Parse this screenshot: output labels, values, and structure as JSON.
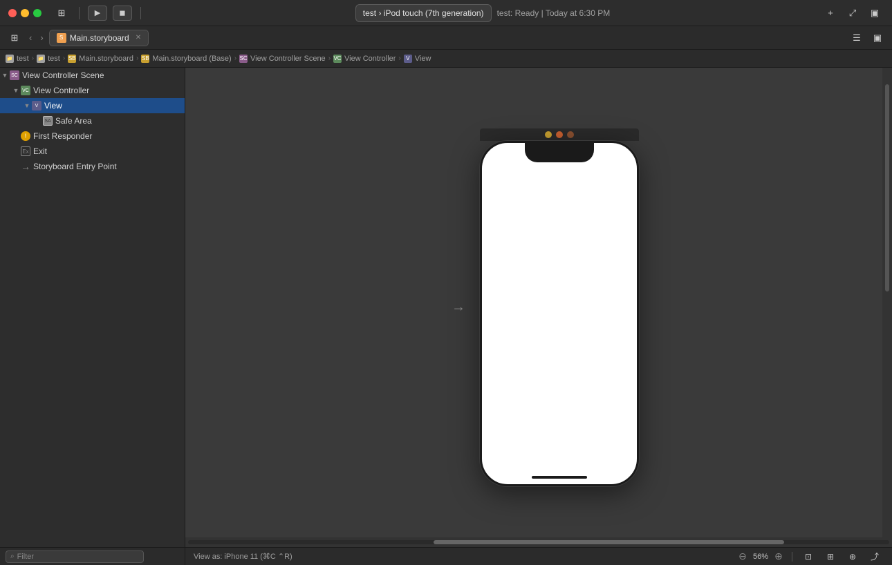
{
  "titlebar": {
    "traffic_lights": [
      "red",
      "yellow",
      "green"
    ],
    "left_btn_label": "⊞",
    "run_btn_label": "▶",
    "stop_btn_label": "◼",
    "device_label": "test  ›  iPod touch (7th generation)",
    "status_label": "test: Ready | Today at 6:30 PM",
    "add_btn_label": "+",
    "maximize_btn_label": "⤢",
    "layout_btn_label": "▣"
  },
  "tabbar": {
    "nav_back": "‹",
    "nav_fwd": "›",
    "tab_label": "Main.storyboard",
    "tab_icon": "S"
  },
  "breadcrumb": {
    "items": [
      {
        "label": "test",
        "icon_type": "folder"
      },
      {
        "label": "test",
        "icon_type": "folder"
      },
      {
        "label": "Main.storyboard",
        "icon_type": "storyboard"
      },
      {
        "label": "Main.storyboard (Base)",
        "icon_type": "storyboard"
      },
      {
        "label": "View Controller Scene",
        "icon_type": "scene"
      },
      {
        "label": "View Controller",
        "icon_type": "vc"
      },
      {
        "label": "View",
        "icon_type": "view"
      }
    ],
    "separator": "›"
  },
  "sidebar": {
    "items": [
      {
        "id": "vc-scene",
        "label": "View Controller Scene",
        "level": 0,
        "icon": "scene",
        "arrow": "▼",
        "selected": false
      },
      {
        "id": "vc",
        "label": "View Controller",
        "level": 1,
        "icon": "vc",
        "arrow": "▼",
        "selected": false
      },
      {
        "id": "view",
        "label": "View",
        "level": 2,
        "icon": "view",
        "arrow": "▼",
        "selected": true
      },
      {
        "id": "safe-area",
        "label": "Safe Area",
        "level": 3,
        "icon": "safe",
        "arrow": "",
        "selected": false
      },
      {
        "id": "first-responder",
        "label": "First Responder",
        "level": 1,
        "icon": "fr",
        "arrow": "",
        "selected": false
      },
      {
        "id": "exit",
        "label": "Exit",
        "level": 1,
        "icon": "exit",
        "arrow": "",
        "selected": false
      },
      {
        "id": "storyboard-entry",
        "label": "Storyboard Entry Point",
        "level": 1,
        "icon": "arrow",
        "arrow": "",
        "selected": false
      }
    ],
    "filter_placeholder": "Filter"
  },
  "canvas": {
    "entry_arrow": "→",
    "device_dots": [
      {
        "color": "yellow"
      },
      {
        "color": "orange"
      },
      {
        "color": "brown"
      }
    ]
  },
  "bottom_bar": {
    "view_as_label": "View as: iPhone 11 (⌘C ⌃R)",
    "zoom_in_icon": "⊕",
    "zoom_out_icon": "⊖",
    "zoom_value": "56%"
  },
  "toolbar_right": {
    "list_icon": "☰",
    "inspector_icon": "▣"
  },
  "colors": {
    "titlebar_bg": "#2d2d2d",
    "sidebar_bg": "#2d2d2d",
    "canvas_bg": "#3a3a3a",
    "selected_bg": "#1e4d8a",
    "tab_bg": "#3d3d3d"
  }
}
